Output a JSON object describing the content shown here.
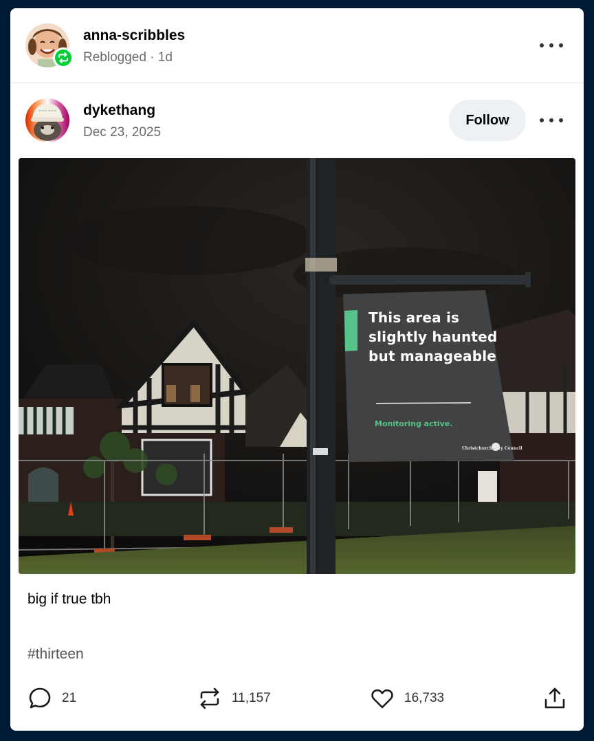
{
  "reblogger": {
    "username": "anna-scribbles",
    "meta": "Reblogged · 1d"
  },
  "author": {
    "username": "dykethang",
    "date": "Dec 23, 2025",
    "follow_label": "Follow"
  },
  "photo": {
    "sign_main": "This area is slightly haunted but manageable",
    "sign_sub": "Monitoring active.",
    "sign_org": "Christchurch City Council"
  },
  "post": {
    "text": "big if true tbh",
    "tag": "#thirteen"
  },
  "actions": {
    "replies": "21",
    "reblogs": "11,157",
    "likes": "16,733"
  },
  "colors": {
    "background": "#001935",
    "card": "#ffffff",
    "reblog_badge": "#00cf35",
    "follow_button": "#eef1f4"
  },
  "icons": [
    "reblog-icon",
    "more-options-icon",
    "reply-icon",
    "likes-heart-icon",
    "share-icon"
  ]
}
